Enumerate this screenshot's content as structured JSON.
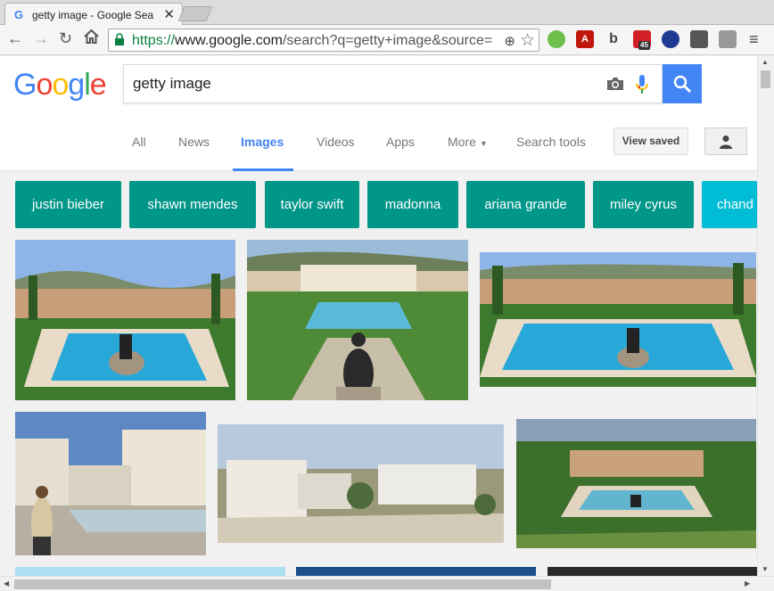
{
  "browser": {
    "tab_title": "getty image - Google Sea",
    "tab_favicon": "G",
    "tab_close": "✕",
    "url_scheme": "https://",
    "url_host": "www.google.com",
    "url_path": "/search?q=getty+image&source=",
    "extension_badge": "45"
  },
  "search": {
    "logo": "Google",
    "query": "getty image"
  },
  "nav": {
    "tabs": [
      {
        "label": "All"
      },
      {
        "label": "News"
      },
      {
        "label": "Images"
      },
      {
        "label": "Videos"
      },
      {
        "label": "Apps"
      },
      {
        "label": "More"
      },
      {
        "label": "Search tools"
      }
    ],
    "active_tab": "Images",
    "view_saved": "View saved"
  },
  "chips": [
    {
      "label": "justin bieber"
    },
    {
      "label": "shawn mendes"
    },
    {
      "label": "taylor swift"
    },
    {
      "label": "madonna"
    },
    {
      "label": "ariana grande"
    },
    {
      "label": "miley cyrus"
    },
    {
      "label": "chand"
    }
  ],
  "colors": {
    "accent": "#4285f4",
    "chip": "#009688",
    "chip_last": "#00bcd4"
  },
  "icons": [
    "back-icon",
    "forward-icon",
    "reload-icon",
    "home-icon",
    "lock-icon",
    "zoom-icon",
    "star-icon",
    "camera-icon",
    "mic-icon",
    "search-icon",
    "person-icon",
    "menu-icon"
  ]
}
